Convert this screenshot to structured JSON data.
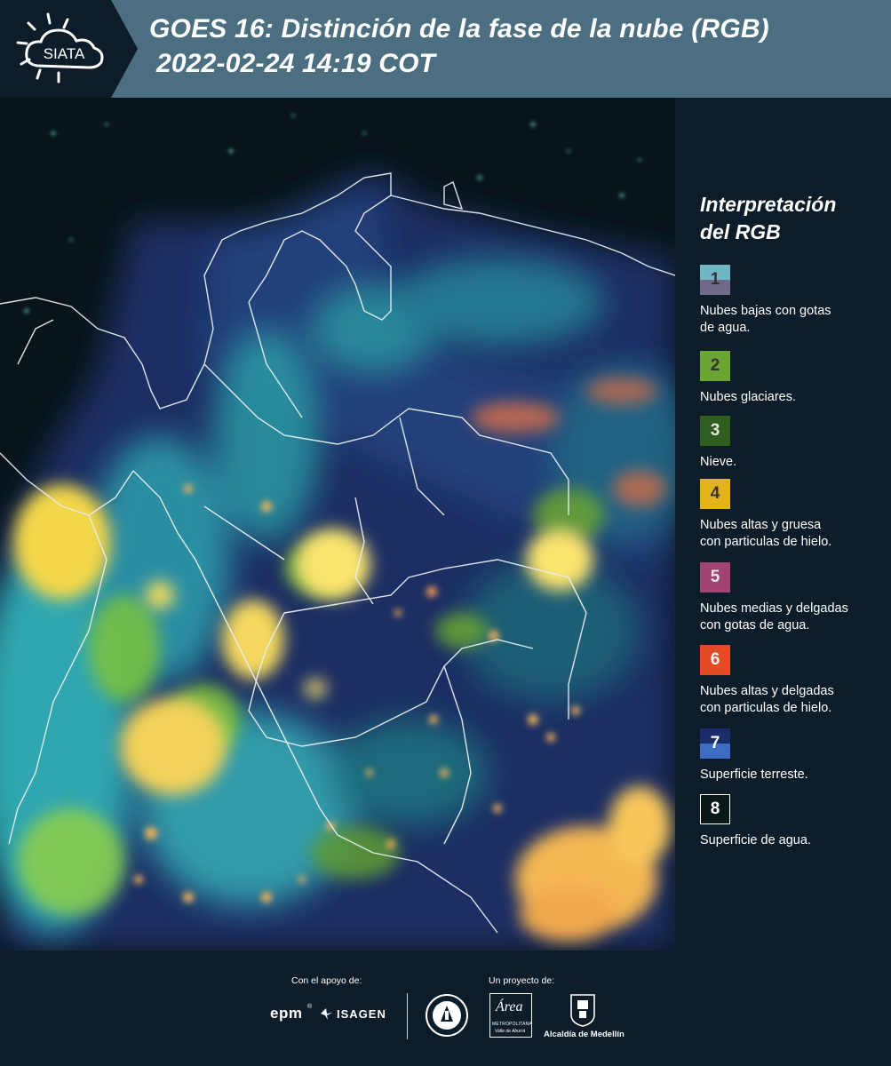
{
  "header": {
    "title_line1": "GOES 16: Distinción de la fase de la nube (RGB)",
    "title_line2": "2022-02-24 14:19 COT",
    "logo_text": "SIATA"
  },
  "legend": {
    "title_line1": "Interpretación",
    "title_line2": "del RGB",
    "items": [
      {
        "num": "1",
        "label_lines": [
          "Nubes bajas con gotas",
          "de agua."
        ],
        "color_top": "#6fb7c4",
        "color_bottom": "#6c6a86",
        "num_color": "#333"
      },
      {
        "num": "2",
        "label_lines": [
          "Nubes glaciares."
        ],
        "color_top": "#6aa533",
        "color_bottom": "#6aa533",
        "num_color": "#333"
      },
      {
        "num": "3",
        "label_lines": [
          "Nieve."
        ],
        "color_top": "#2f5c1f",
        "color_bottom": "#2f5c1f",
        "num_color": "#dfe8d8"
      },
      {
        "num": "4",
        "label_lines": [
          "Nubes altas y gruesa",
          "con particulas de hielo."
        ],
        "color_top": "#e3b31d",
        "color_bottom": "#e3b31d",
        "num_color": "#333"
      },
      {
        "num": "5",
        "label_lines": [
          "Nubes medias y delgadas",
          "con gotas de agua."
        ],
        "color_top": "#a0456f",
        "color_bottom": "#a0456f",
        "num_color": "#f0e4ea"
      },
      {
        "num": "6",
        "label_lines": [
          "Nubes altas y delgadas",
          "con particulas de hielo."
        ],
        "color_top": "#e24b26",
        "color_bottom": "#e24b26",
        "num_color": "#fff"
      },
      {
        "num": "7",
        "label_lines": [
          "Superficie terreste."
        ],
        "color_top": "#1b2c6b",
        "color_bottom": "#3c6dc0",
        "num_color": "#fff"
      },
      {
        "num": "8",
        "label_lines": [
          "Superficie de agua."
        ],
        "color_top": "#0b1818",
        "color_bottom": "#0b1818",
        "num_color": "#fff"
      }
    ]
  },
  "footer": {
    "support_label": "Con el apoyo de:",
    "project_label": "Un proyecto de:",
    "sponsors": [
      "epm",
      "ISAGEN"
    ],
    "area_lines": [
      "Área",
      "METROPOLITANA",
      "Valle de Aburrá"
    ],
    "alcaldia": "Alcaldía de Medellín"
  },
  "colors": {
    "background": "#0c1c28",
    "title_band": "#4b6f80"
  }
}
